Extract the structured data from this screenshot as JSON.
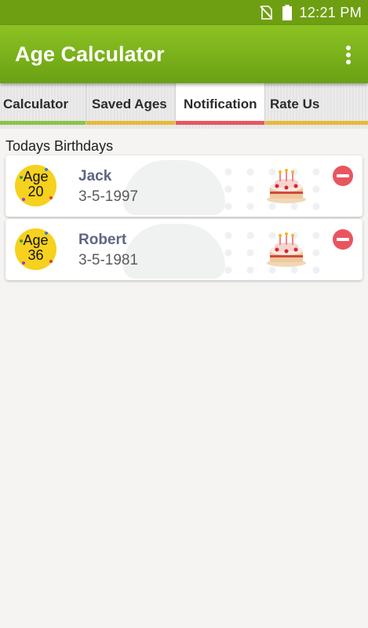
{
  "status_bar": {
    "time": "12:21 PM",
    "icons": [
      "no-sim-icon",
      "battery-icon"
    ]
  },
  "app": {
    "title": "Age Calculator",
    "menu_icon": "overflow-menu-icon"
  },
  "tabs": [
    {
      "label": "Calculator",
      "color": "#8bc34a",
      "active": false
    },
    {
      "label": "Saved Ages",
      "color": "#e8b93a",
      "active": false
    },
    {
      "label": "Notification",
      "color": "#e9555f",
      "active": true
    },
    {
      "label": "Rate Us",
      "color": "#e8b93a",
      "active": false
    }
  ],
  "section": {
    "label": "Todays Birthdays"
  },
  "birthdays": [
    {
      "age_word": "Age",
      "age": "20",
      "name": "Jack",
      "dob": "3-5-1997"
    },
    {
      "age_word": "Age",
      "age": "36",
      "name": "Robert",
      "dob": "3-5-1981"
    }
  ],
  "colors": {
    "accent": "#7bb11a",
    "status_bar": "#6e9f12",
    "remove": "#e9555f",
    "badge": "#f6d11d"
  }
}
